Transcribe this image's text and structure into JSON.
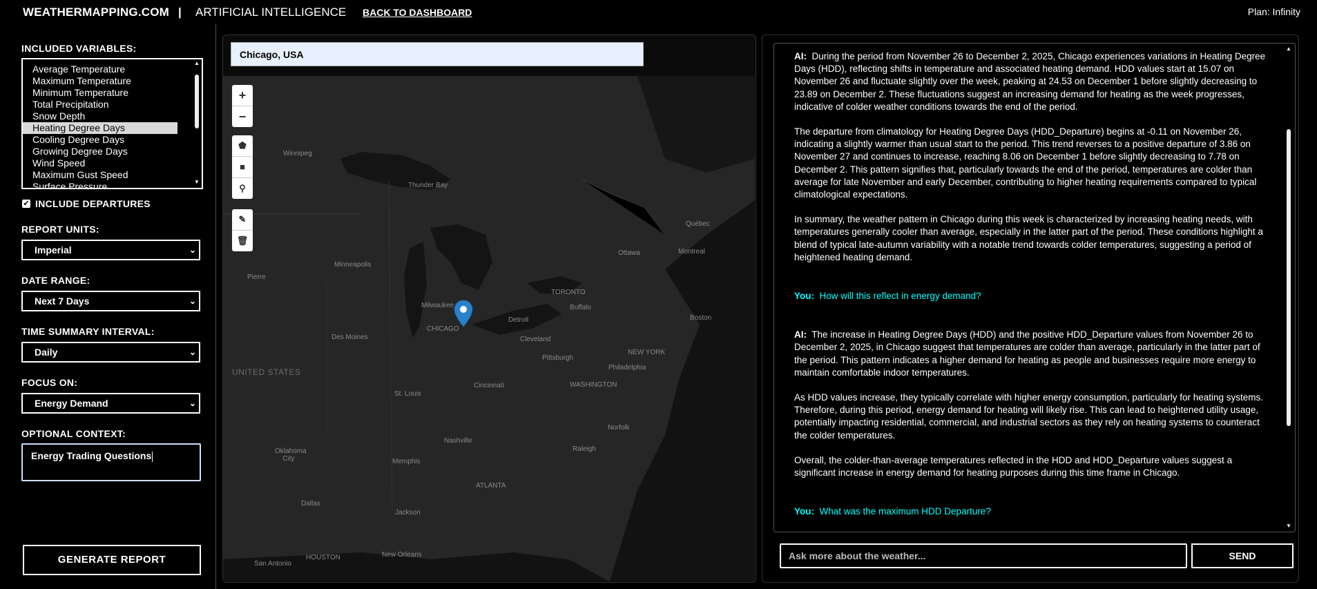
{
  "header": {
    "brand": "WEATHERMAPPING.COM",
    "separator": "|",
    "section": "ARTIFICIAL INTELLIGENCE",
    "back_link": "BACK TO DASHBOARD",
    "plan": "Plan: Infinity"
  },
  "sidebar": {
    "variables_label": "INCLUDED VARIABLES:",
    "variables": [
      {
        "label": "Average Temperature",
        "selected": false
      },
      {
        "label": "Maximum Temperature",
        "selected": false
      },
      {
        "label": "Minimum Temperature",
        "selected": false
      },
      {
        "label": "Total Precipitation",
        "selected": false
      },
      {
        "label": "Snow Depth",
        "selected": false
      },
      {
        "label": "Heating Degree Days",
        "selected": true
      },
      {
        "label": "Cooling Degree Days",
        "selected": false
      },
      {
        "label": "Growing Degree Days",
        "selected": false
      },
      {
        "label": "Wind Speed",
        "selected": false
      },
      {
        "label": "Maximum Gust Speed",
        "selected": false
      },
      {
        "label": "Surface Pressure",
        "selected": false
      }
    ],
    "include_departures_label": "INCLUDE DEPARTURES",
    "include_departures_checked": true,
    "report_units_label": "REPORT UNITS:",
    "report_units_value": "Imperial",
    "date_range_label": "DATE RANGE:",
    "date_range_value": "Next 7 Days",
    "interval_label": "TIME SUMMARY INTERVAL:",
    "interval_value": "Daily",
    "focus_label": "FOCUS ON:",
    "focus_value": "Energy Demand",
    "context_label": "OPTIONAL CONTEXT:",
    "context_value": "Energy Trading Questions",
    "generate_button": "GENERATE REPORT"
  },
  "map": {
    "search_value": "Chicago, USA",
    "zoom_in": "+",
    "zoom_out": "−",
    "labels": {
      "winnipeg": "Winnipeg",
      "thunder_bay": "Thunder Bay",
      "quebec": "Québec",
      "ottawa": "Ottawa",
      "montreal": "Montreal",
      "minneapolis": "Minneapolis",
      "pierre": "Pierre",
      "milwaukee": "Milwaukee",
      "toronto": "TORONTO",
      "buffalo": "Buffalo",
      "chicago": "CHICAGO",
      "detroit": "Detroit",
      "boston": "Boston",
      "des_moines": "Des Moines",
      "cleveland": "Cleveland",
      "new_york": "NEW YORK",
      "pittsburgh": "Pittsburgh",
      "philadelphia": "Philadelphia",
      "united_states": "UNITED STATES",
      "washington": "WASHINGTON",
      "st_louis": "St. Louis",
      "cincinnati": "Cincinnati",
      "nashville": "Nashville",
      "norfolk": "Norfolk",
      "oklahoma_city": "Oklahoma City",
      "memphis": "Memphis",
      "raleigh": "Raleigh",
      "atlanta": "ATLANTA",
      "dallas": "Dallas",
      "jackson": "Jackson",
      "houston": "HOUSTON",
      "new_orleans": "New Orleans",
      "san_antonio": "San Antonio"
    }
  },
  "chat": {
    "messages": [
      {
        "role": "ai",
        "prefix": "AI:",
        "paragraphs": [
          "During the period from November 26 to December 2, 2025, Chicago experiences variations in Heating Degree Days (HDD), reflecting shifts in temperature and associated heating demand. HDD values start at 15.07 on November 26 and fluctuate slightly over the week, peaking at 24.53 on December 1 before slightly decreasing to 23.89 on December 2. These fluctuations suggest an increasing demand for heating as the week progresses, indicative of colder weather conditions towards the end of the period.",
          "The departure from climatology for Heating Degree Days (HDD_Departure) begins at -0.11 on November 26, indicating a slightly warmer than usual start to the period. This trend reverses to a positive departure of 3.86 on November 27 and continues to increase, reaching 8.06 on December 1 before slightly decreasing to 7.78 on December 2. This pattern signifies that, particularly towards the end of the period, temperatures are colder than average for late November and early December, contributing to higher heating requirements compared to typical climatological expectations.",
          "In summary, the weather pattern in Chicago during this week is characterized by increasing heating needs, with temperatures generally cooler than average, especially in the latter part of the period. These conditions highlight a blend of typical late-autumn variability with a notable trend towards colder temperatures, suggesting a period of heightened heating demand."
        ]
      },
      {
        "role": "user",
        "prefix": "You:",
        "text": "How will this reflect in energy demand?"
      },
      {
        "role": "ai",
        "prefix": "AI:",
        "paragraphs": [
          "The increase in Heating Degree Days (HDD) and the positive HDD_Departure values from November 26 to December 2, 2025, in Chicago suggest that temperatures are colder than average, particularly in the latter part of the period. This pattern indicates a higher demand for heating as people and businesses require more energy to maintain comfortable indoor temperatures.",
          "As HDD values increase, they typically correlate with higher energy consumption, particularly for heating systems. Therefore, during this period, energy demand for heating will likely rise. This can lead to heightened utility usage, potentially impacting residential, commercial, and industrial sectors as they rely on heating systems to counteract the colder temperatures.",
          "Overall, the colder-than-average temperatures reflected in the HDD and HDD_Departure values suggest a significant increase in energy demand for heating purposes during this time frame in Chicago."
        ]
      },
      {
        "role": "user",
        "prefix": "You:",
        "text": "What was the maximum HDD Departure?"
      }
    ],
    "input_placeholder": "Ask more about the weather...",
    "send_button": "SEND"
  }
}
